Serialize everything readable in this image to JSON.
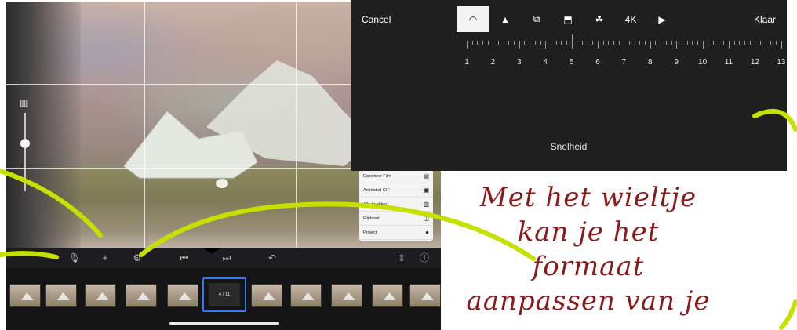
{
  "settings_panel": {
    "cancel_label": "Cancel",
    "done_label": "Klaar",
    "tabs": [
      {
        "icon": "speed-icon",
        "glyph": "◠",
        "active": true
      },
      {
        "icon": "triangle-up-icon",
        "glyph": "▲",
        "active": false
      },
      {
        "icon": "aspect-ratio-icon",
        "glyph": "⧉",
        "active": false
      },
      {
        "icon": "crop-icon",
        "glyph": "⬒",
        "active": false
      },
      {
        "icon": "filters-icon",
        "glyph": "☘",
        "active": false
      },
      {
        "icon": "resolution-4k-icon",
        "label": "4K",
        "active": false
      },
      {
        "icon": "youtube-icon",
        "glyph": "▶",
        "active": false
      }
    ],
    "ruler_numbers": [
      "1",
      "2",
      "3",
      "4",
      "5",
      "6",
      "7",
      "8",
      "9",
      "10",
      "11",
      "12",
      "13"
    ],
    "selected_value": "5",
    "caption": "Snelheid"
  },
  "export_menu": {
    "items": [
      {
        "label": "Exporteer Film",
        "icon": "film-icon",
        "glyph": "▤"
      },
      {
        "label": "Animated GIF",
        "icon": "gif-icon",
        "glyph": "▣"
      },
      {
        "label": "Alle beelden",
        "icon": "images-icon",
        "glyph": "▧"
      },
      {
        "label": "Flipboek",
        "icon": "book-icon",
        "glyph": "◫"
      },
      {
        "label": "Project",
        "icon": "apple-icon",
        "glyph": "●"
      }
    ]
  },
  "toolbar": {
    "icons": [
      "mic-icon",
      "plus-icon",
      "settings-icon",
      "skip-back-icon",
      "skip-forward-icon",
      "undo-icon",
      "share-icon",
      "help-icon"
    ]
  },
  "filmstrip": {
    "selected_label": "4 / 11",
    "frame_count": 11
  },
  "annotation": {
    "lines": [
      "Met het wieltje",
      "kan je  het",
      "formaat",
      "aanpassen van je"
    ]
  },
  "colors": {
    "accent": "#3478f6",
    "arc": "#c7e000",
    "annotation_text": "#8b1a1a",
    "ruler_marker": "#e0a000"
  }
}
